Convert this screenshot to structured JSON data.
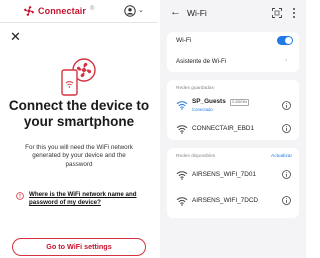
{
  "left": {
    "brand": "Connectair",
    "brand_mark": "®",
    "title": "Connect the device to your smartphone",
    "description": "For this you will need the WiFi network generated by your device and the password",
    "help_link": "Where is the WiFi network name and password of my device?",
    "cta_label": "Go to WiFi settings",
    "icons": [
      "fan-logo-icon",
      "account-icon",
      "chevron-down-icon",
      "close-icon",
      "phone-fan-icon",
      "info-circle-icon"
    ],
    "accent_color": "#c8122c"
  },
  "right": {
    "back_glyph": "←",
    "title": "Wi-Fi",
    "wifi_label": "Wi-Fi",
    "wifi_on": true,
    "assistant_label": "Asistente de Wi-Fi",
    "saved_section": "Redes guardadas",
    "saved": [
      {
        "ssid": "SP_Guests",
        "badge": "2.4/5GHz",
        "status": "Conectado"
      },
      {
        "ssid": "CONNECTAIR_EBD1"
      }
    ],
    "available_section": "Redes disponibles",
    "refresh_label": "Actualizar",
    "available": [
      {
        "ssid": "AIRSENS_WIFI_7D01"
      },
      {
        "ssid": "AIRSENS_WIFI_7DCD"
      }
    ],
    "accent_color": "#1f7ae6"
  }
}
